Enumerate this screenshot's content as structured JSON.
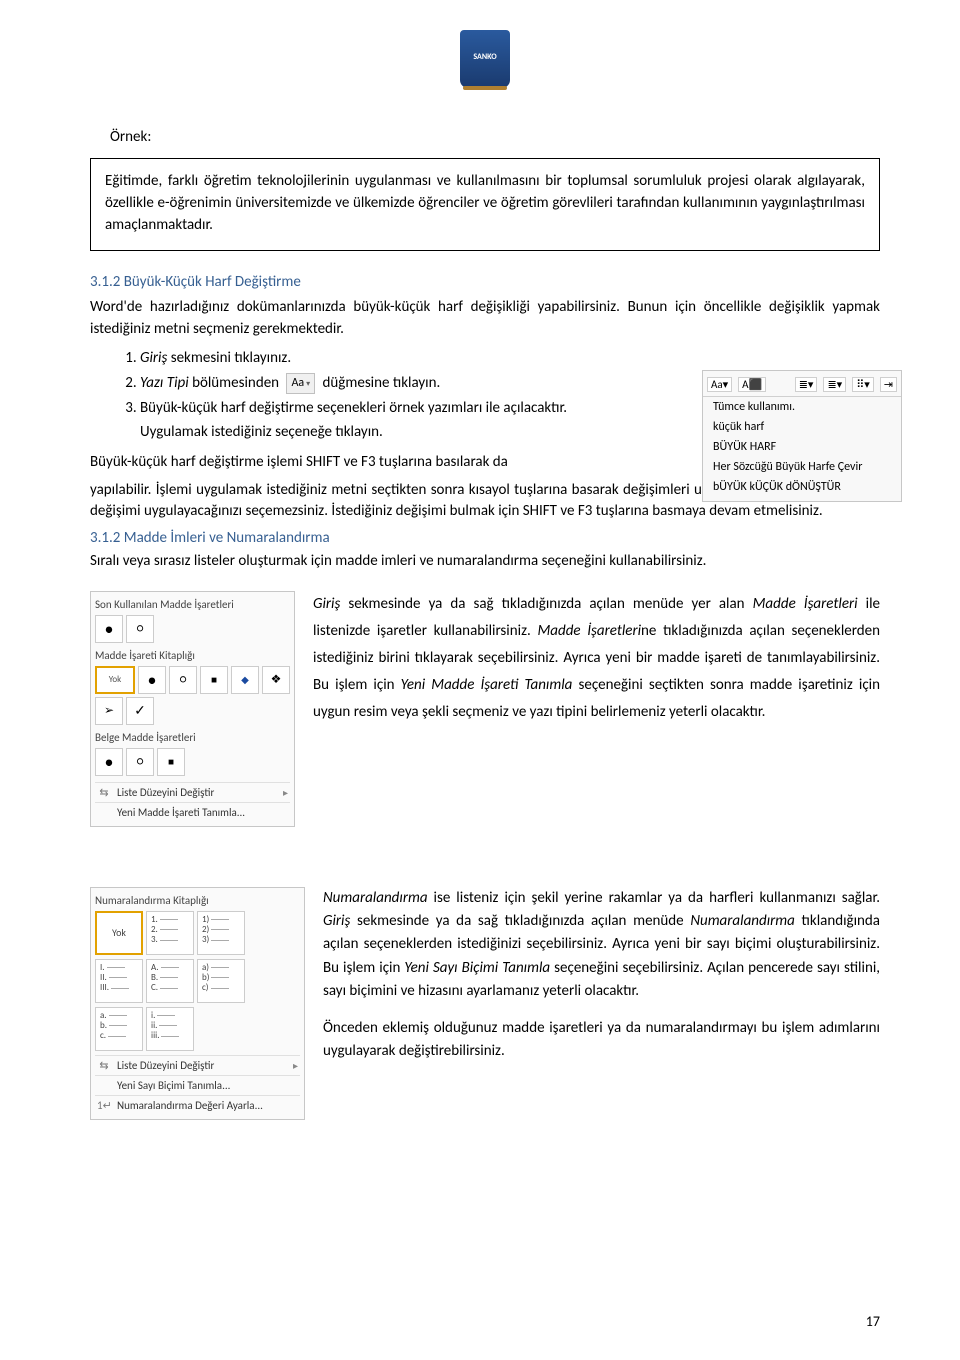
{
  "logo_text": "SANKO",
  "ornek_label": "Örnek:",
  "boxed_text": "Eğitimde, farklı öğretim teknolojilerinin uygulanması ve kullanılmasını bir toplumsal sorumluluk projesi olarak algılayarak, özellikle e-öğrenimin üniversitemizde ve ülkemizde öğrenciler ve öğretim görevlileri tarafından kullanımının yaygınlaştırılması amaçlanmaktadır.",
  "heading_312": "3.1.2 Büyük-Küçük Harf Değiştirme",
  "para_312": "Word'de hazırladığınız dokümanlarınızda büyük-küçük harf değişikliği yapabilirsiniz. Bunun için öncellikle değişiklik yapmak istediğiniz metni seçmeniz gerekmektedir.",
  "step1_a": "Giriş",
  "step1_b": " sekmesini tıklayınız.",
  "step2_a": "Yazı Tipi",
  "step2_b": " bölümesinden ",
  "step2_c": " düğmesine tıklayın.",
  "aa_label": "Aa",
  "step3": "Büyük-küçük harf değiştirme seçenekleri örnek yazımları ile açılacaktır. Uygulamak istediğiniz seçeneğe tıklayın.",
  "case_menu": {
    "items": [
      "Tümce kullanımı.",
      "küçük harf",
      "BÜYÜK HARF",
      "Her Sözcüğü Büyük Harfe Çevir",
      "bÜYÜK kÜÇÜK dÖNÜŞTÜR"
    ]
  },
  "para_after_steps_1": "Büyük-küçük harf değiştirme işlemi SHIFT ve F3 tuşlarına basılarak da",
  "para_after_steps_2": "yapılabilir. İşlemi uygulamak istediğiniz metni seçtikten sonra kısayol tuşlarına basarak değişimleri uygulayabilirsiniz. Ancak hangi değişimi uygulayacağınızı seçemezsiniz. İstediğiniz değişimi bulmak için SHIFT ve F3 tuşlarına basmaya devam etmelisiniz.",
  "heading_312b": "3.1.2 Madde İmleri ve Numaralandırma",
  "para_312b": "Sıralı veya sırasız listeler oluşturmak için madde imleri ve numaralandırma seçeneğini kullanabilirsiniz.",
  "bullet_panel": {
    "recent_label": "Son Kullanılan Madde İşaretleri",
    "library_label": "Madde İşareti Kitaplığı",
    "doc_label": "Belge Madde İşaretleri",
    "yok": "Yok",
    "change_level": "Liste Düzeyini Değiştir",
    "define_new": "Yeni Madde İşareti Tanımla..."
  },
  "bullets_para_parts": {
    "a": "Giriş",
    "b": " sekmesinde ya da sağ tıkladığınızda açılan menüde yer alan ",
    "c": "Madde İşaretleri",
    "d": " ile listenizde işaretler kullanabilirsiniz. ",
    "e": "Madde İşaretleri",
    "f": "ne tıkladığınızda açılan seçeneklerden istediğiniz birini tıklayarak seçebilirsiniz. Ayrıca yeni bir madde işareti de tanımlayabilirsiniz. Bu işlem için ",
    "g": "Yeni Madde İşareti Tanımla",
    "h": " seçeneğini seçtikten sonra madde işaretiniz için uygun resim veya şekli seçmeniz ve yazı tipini belirlemeniz yeterli olacaktır."
  },
  "num_panel": {
    "library_label": "Numaralandırma Kitaplığı",
    "yok": "Yok",
    "change_level": "Liste Düzeyini Değiştir",
    "define_new": "Yeni Sayı Biçimi Tanımla...",
    "set_value": "Numaralandırma Değeri Ayarla...",
    "styles": [
      [
        "1.",
        "2.",
        "3."
      ],
      [
        "1)",
        "2)",
        "3)"
      ],
      [
        "I.",
        "II.",
        "III."
      ],
      [
        "A.",
        "B.",
        "C."
      ],
      [
        "a)",
        "b)",
        "c)"
      ],
      [
        "a.",
        "b.",
        "c."
      ],
      [
        "i.",
        "ii.",
        "iii."
      ]
    ]
  },
  "num_para_1_parts": {
    "a": "Numaralandırma",
    "b": " ise listeniz için şekil yerine rakamlar ya da harfleri kullanmanızı sağlar. ",
    "c": "Giriş",
    "d": " sekmesinde ya da sağ tıkladığınızda açılan menüde ",
    "e": "Numaralandırma",
    "f": " tıklandığında açılan seçeneklerden istediğinizi seçebilirsiniz. Ayrıca yeni bir sayı biçimi oluşturabilirsiniz. Bu işlem için ",
    "g": "Yeni Sayı Biçimi Tanımla",
    "h": " seçeneğini seçebilirsiniz. Açılan pencerede sayı stilini, sayı biçimini ve hizasını ayarlamanız yeterli olacaktır."
  },
  "num_para_2": "Önceden eklemiş olduğunuz madde işaretleri ya da numaralandırmayı bu işlem adımlarını uygulayarak değiştirebilirsiniz.",
  "page_number": "17"
}
